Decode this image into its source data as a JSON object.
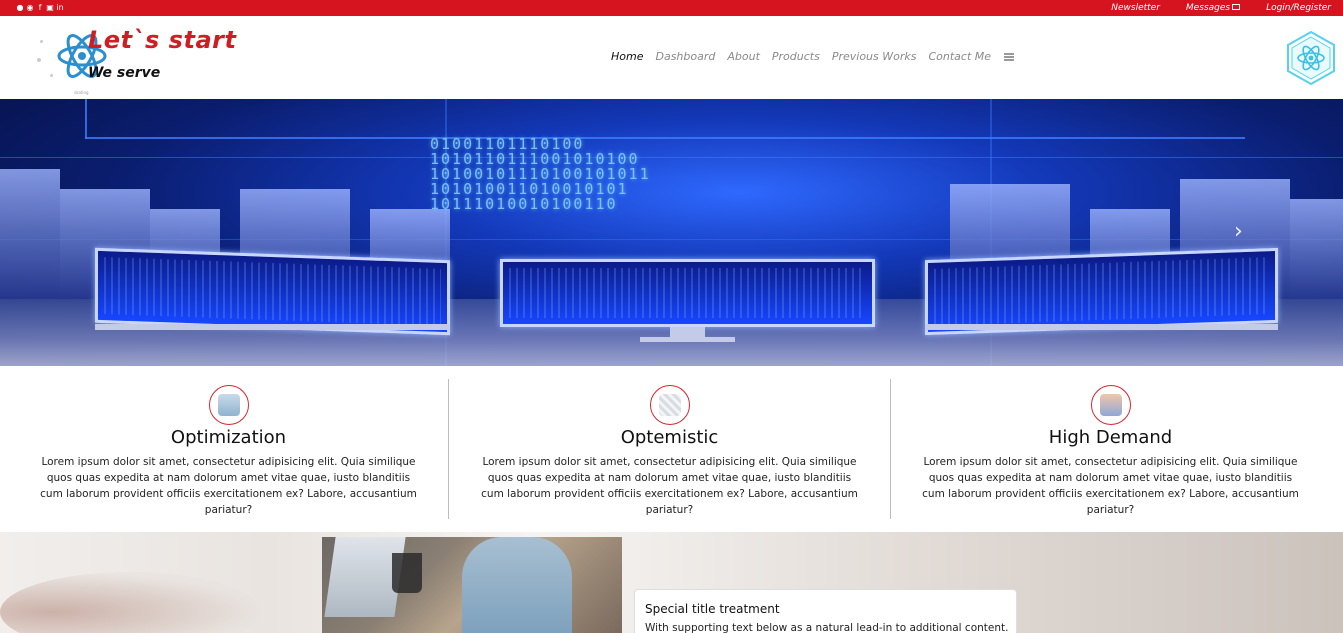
{
  "topbar": {
    "color": "#d6141f",
    "social_icons": [
      "user-icon",
      "github-icon",
      "facebook-icon",
      "instagram-icon",
      "linkedin-icon"
    ],
    "links": {
      "newsletter": "Newsletter",
      "messages": "Messages",
      "login": "Login/Register"
    }
  },
  "brand": {
    "title": "Let`s start",
    "subtitle": "We serve",
    "tiny": "skating",
    "accent": "#cf1d24"
  },
  "nav": {
    "items": [
      "Home",
      "Dashboard",
      "About",
      "Products",
      "Previous Works",
      "Contact Me"
    ],
    "active": "Home"
  },
  "hero": {
    "next_glyph": "›",
    "binary": "01001101110100\n1010110111001010100\n10100101110100101011\n101010011010010101\n10111010010100110"
  },
  "features": [
    {
      "title": "Optimization",
      "text": "Lorem ipsum dolor sit amet, consectetur adipisicing elit. Quia similique quos quas expedita at nam dolorum amet vitae quae, iusto blanditiis cum laborum provident officiis exercitationem ex? Labore, accusantium pariatur?"
    },
    {
      "title": "Optemistic",
      "text": "Lorem ipsum dolor sit amet, consectetur adipisicing elit. Quia similique quos quas expedita at nam dolorum amet vitae quae, iusto blanditiis cum laborum provident officiis exercitationem ex? Labore, accusantium pariatur?"
    },
    {
      "title": "High Demand",
      "text": "Lorem ipsum dolor sit amet, consectetur adipisicing elit. Quia similique quos quas expedita at nam dolorum amet vitae quae, iusto blanditiis cum laborum provident officiis exercitationem ex? Labore, accusantium pariatur?"
    }
  ],
  "card": {
    "title": "Special title treatment",
    "text": "With supporting text below as a natural lead-in to additional content."
  }
}
